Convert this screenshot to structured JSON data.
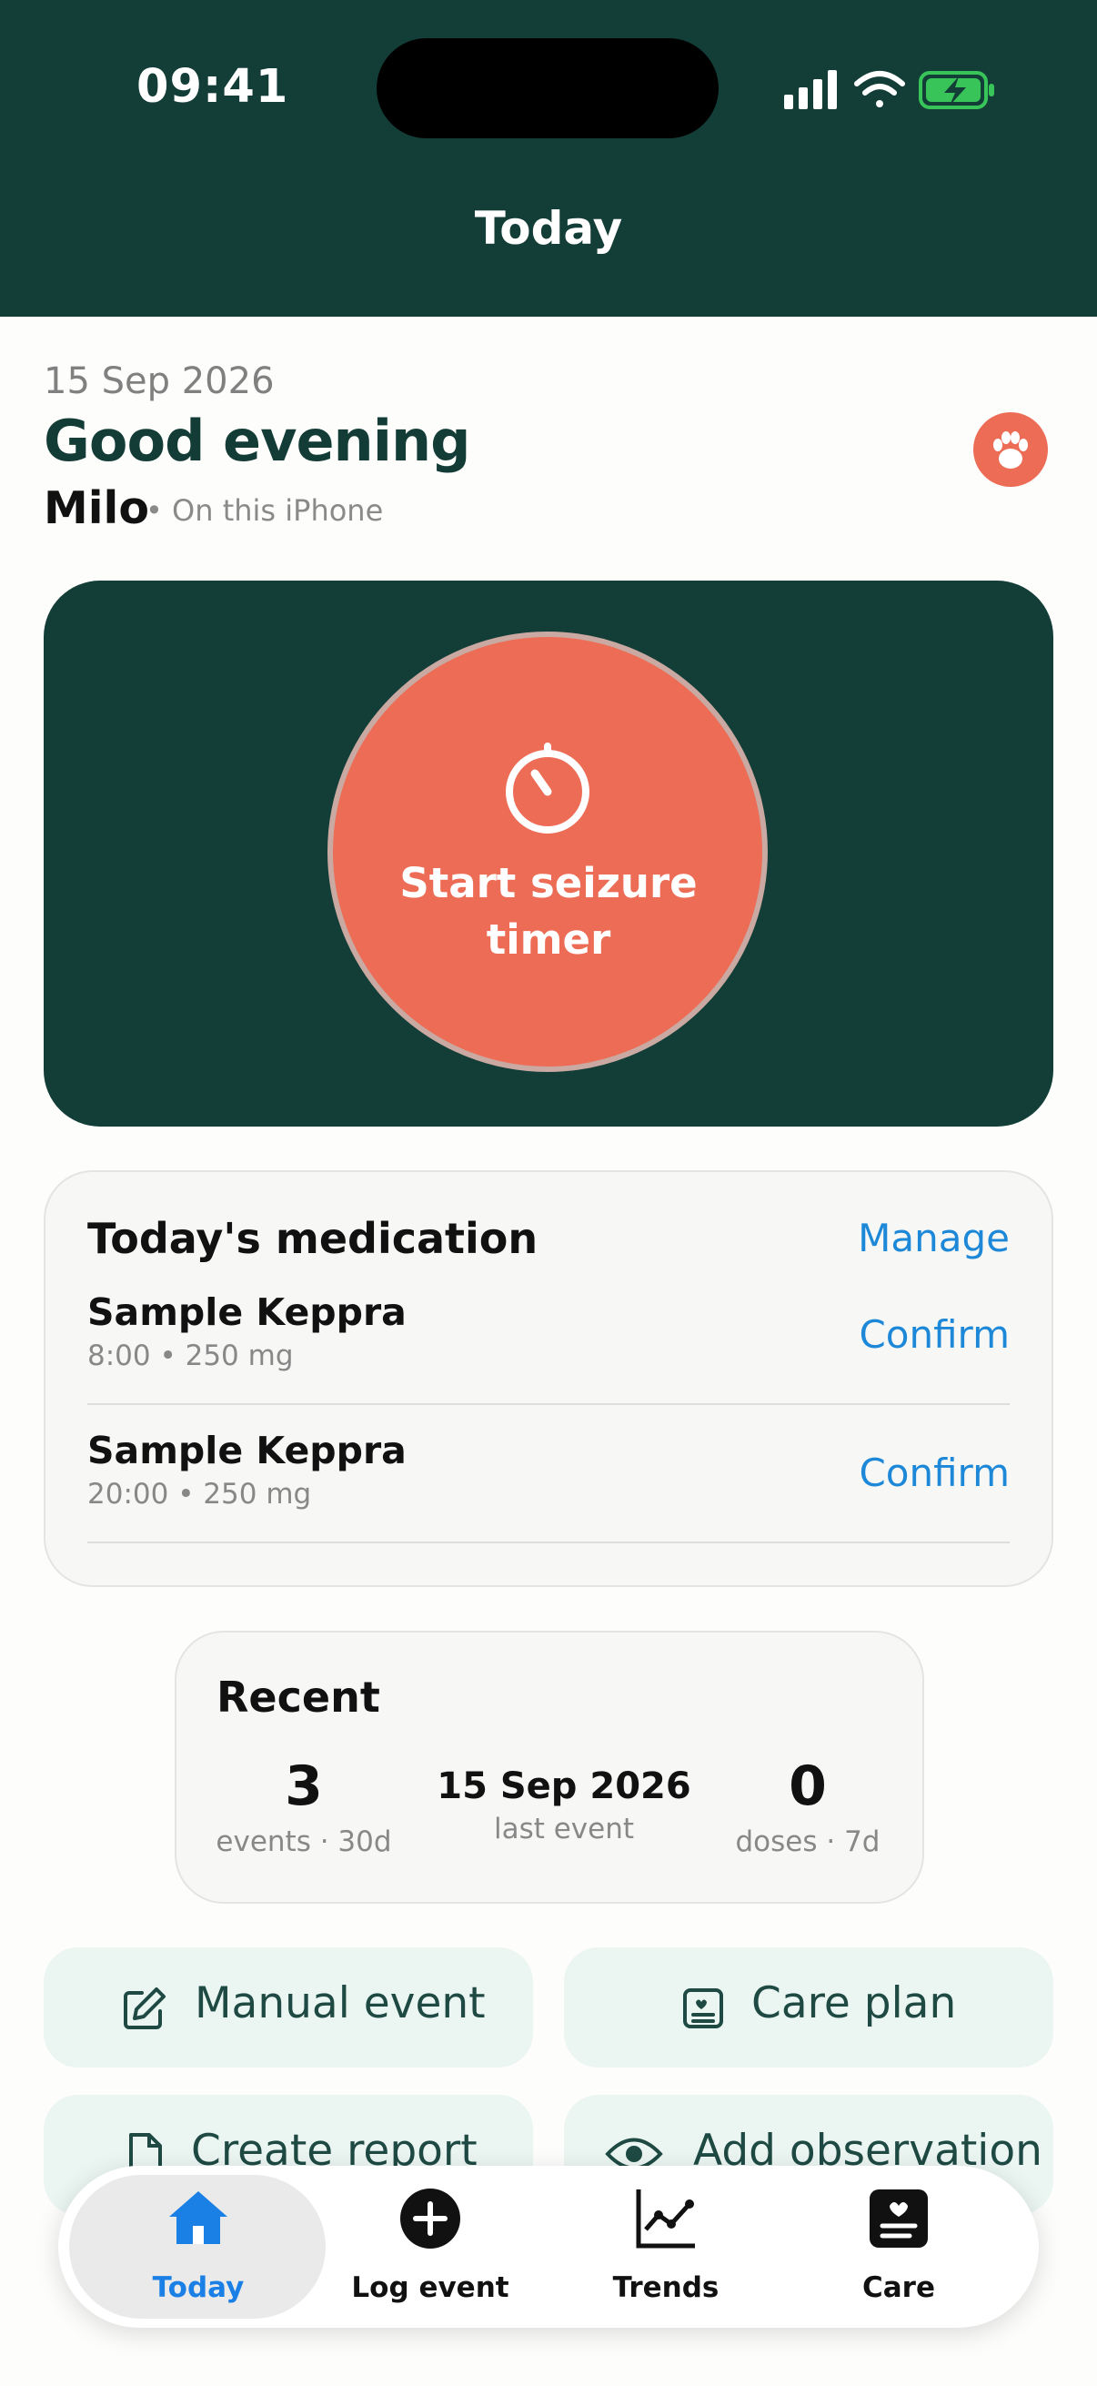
{
  "status_bar": {
    "time": "09:41"
  },
  "nav": {
    "title": "Today"
  },
  "header": {
    "date": "15 Sep 2026",
    "greeting": "Good evening",
    "pet_name": "Milo",
    "pet_sub": "• On this iPhone",
    "avatar_icon": "paw-icon"
  },
  "timer": {
    "label": "Start seizure timer",
    "icon": "stopwatch-icon"
  },
  "medication": {
    "title": "Today's medication",
    "manage_label": "Manage",
    "items": [
      {
        "name": "Sample Keppra",
        "detail": "8:00 • 250 mg",
        "action": "Confirm"
      },
      {
        "name": "Sample Keppra",
        "detail": "20:00 • 250 mg",
        "action": "Confirm"
      }
    ]
  },
  "recent": {
    "title": "Recent",
    "stats": [
      {
        "value": "3",
        "label": "events · 30d"
      },
      {
        "value": "15 Sep 2026",
        "label": "last event"
      },
      {
        "value": "0",
        "label": "doses · 7d"
      }
    ]
  },
  "actions": [
    {
      "label": "Manual event",
      "icon": "edit-icon"
    },
    {
      "label": "Care plan",
      "icon": "care-plan-icon"
    },
    {
      "label": "Create report",
      "icon": "document-icon"
    },
    {
      "label": "Add observation",
      "icon": "eye-icon"
    }
  ],
  "tabs": [
    {
      "label": "Today",
      "icon": "home-icon",
      "selected": true
    },
    {
      "label": "Log event",
      "icon": "plus-circle-icon",
      "selected": false
    },
    {
      "label": "Trends",
      "icon": "trends-icon",
      "selected": false
    },
    {
      "label": "Care",
      "icon": "care-icon",
      "selected": false
    }
  ],
  "colors": {
    "primary": "#133d37",
    "accent": "#ec6c56",
    "link": "#1e88d8",
    "tab_selected": "#1a80e6",
    "action_bg": "#ebf5f2"
  }
}
